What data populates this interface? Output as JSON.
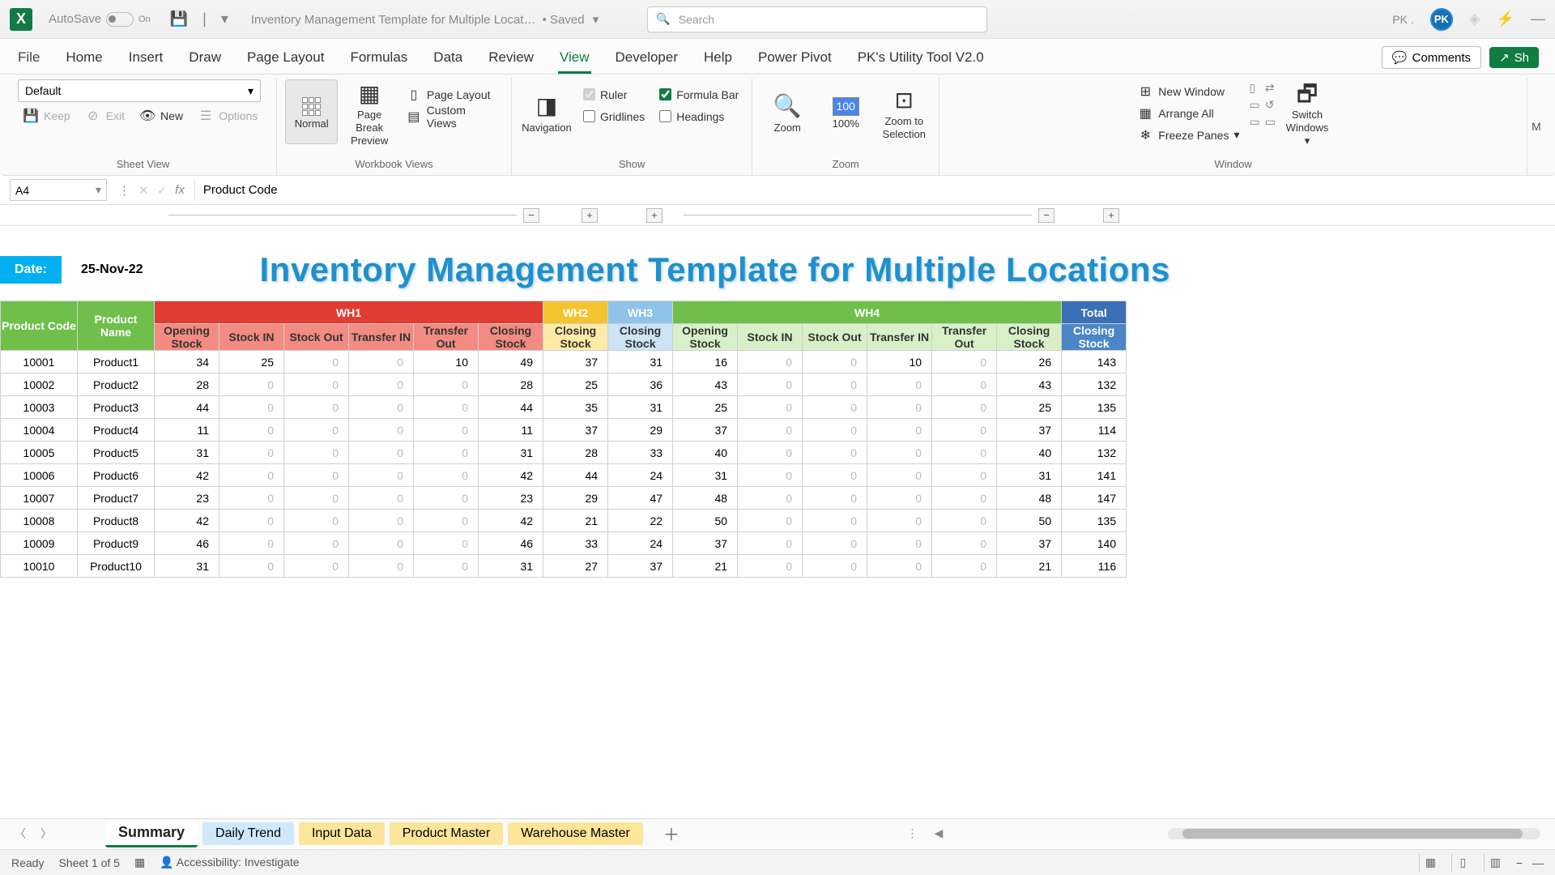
{
  "title_bar": {
    "autosave_label": "AutoSave",
    "autosave_state": "On",
    "file_name": "Inventory Management Template for Multiple Locat…",
    "saved_state": "• Saved",
    "search_placeholder": "Search",
    "user_initials": "PK ."
  },
  "tabs": {
    "file": "File",
    "home": "Home",
    "insert": "Insert",
    "draw": "Draw",
    "page_layout": "Page Layout",
    "formulas": "Formulas",
    "data": "Data",
    "review": "Review",
    "view": "View",
    "developer": "Developer",
    "help": "Help",
    "power_pivot": "Power Pivot",
    "pk_tool": "PK's Utility Tool V2.0",
    "comments": "Comments",
    "share": "Sh"
  },
  "ribbon": {
    "sheet_view": {
      "select": "Default",
      "keep": "Keep",
      "exit": "Exit",
      "new": "New",
      "options": "Options",
      "group": "Sheet View"
    },
    "workbook_views": {
      "normal": "Normal",
      "page_break": "Page Break Preview",
      "page_layout": "Page Layout",
      "custom_views": "Custom Views",
      "group": "Workbook Views"
    },
    "navigation": {
      "nav": "Navigation"
    },
    "show": {
      "ruler": "Ruler",
      "formula_bar": "Formula Bar",
      "gridlines": "Gridlines",
      "headings": "Headings",
      "group": "Show"
    },
    "zoom": {
      "zoom": "Zoom",
      "z100": "100%",
      "zoom_sel": "Zoom to Selection",
      "group": "Zoom"
    },
    "window": {
      "new_window": "New Window",
      "arrange_all": "Arrange All",
      "freeze_panes": "Freeze Panes",
      "switch": "Switch Windows",
      "group": "Window"
    }
  },
  "formula_bar": {
    "cell": "A4",
    "formula": "Product Code"
  },
  "sheet": {
    "date_label": "Date:",
    "date_value": "25-Nov-22",
    "title": "Inventory Management Template for Multiple Locations",
    "groups": {
      "wh1": "WH1",
      "wh2": "WH2",
      "wh3": "WH3",
      "wh4": "WH4",
      "total": "Total"
    },
    "headers": {
      "pcode": "Product Code",
      "pname": "Product Name",
      "open": "Opening Stock",
      "sin": "Stock IN",
      "sout": "Stock Out",
      "tin": "Transfer IN",
      "tout": "Transfer Out",
      "close": "Closing Stock"
    },
    "rows": [
      {
        "code": "10001",
        "name": "Product1",
        "w1": [
          34,
          25,
          0,
          0,
          10,
          49
        ],
        "w2c": 37,
        "w3c": 31,
        "w4": [
          16,
          0,
          0,
          10,
          0,
          26
        ],
        "tot": 143
      },
      {
        "code": "10002",
        "name": "Product2",
        "w1": [
          28,
          0,
          0,
          0,
          0,
          28
        ],
        "w2c": 25,
        "w3c": 36,
        "w4": [
          43,
          0,
          0,
          0,
          0,
          43
        ],
        "tot": 132
      },
      {
        "code": "10003",
        "name": "Product3",
        "w1": [
          44,
          0,
          0,
          0,
          0,
          44
        ],
        "w2c": 35,
        "w3c": 31,
        "w4": [
          25,
          0,
          0,
          0,
          0,
          25
        ],
        "tot": 135
      },
      {
        "code": "10004",
        "name": "Product4",
        "w1": [
          11,
          0,
          0,
          0,
          0,
          11
        ],
        "w2c": 37,
        "w3c": 29,
        "w4": [
          37,
          0,
          0,
          0,
          0,
          37
        ],
        "tot": 114
      },
      {
        "code": "10005",
        "name": "Product5",
        "w1": [
          31,
          0,
          0,
          0,
          0,
          31
        ],
        "w2c": 28,
        "w3c": 33,
        "w4": [
          40,
          0,
          0,
          0,
          0,
          40
        ],
        "tot": 132
      },
      {
        "code": "10006",
        "name": "Product6",
        "w1": [
          42,
          0,
          0,
          0,
          0,
          42
        ],
        "w2c": 44,
        "w3c": 24,
        "w4": [
          31,
          0,
          0,
          0,
          0,
          31
        ],
        "tot": 141
      },
      {
        "code": "10007",
        "name": "Product7",
        "w1": [
          23,
          0,
          0,
          0,
          0,
          23
        ],
        "w2c": 29,
        "w3c": 47,
        "w4": [
          48,
          0,
          0,
          0,
          0,
          48
        ],
        "tot": 147
      },
      {
        "code": "10008",
        "name": "Product8",
        "w1": [
          42,
          0,
          0,
          0,
          0,
          42
        ],
        "w2c": 21,
        "w3c": 22,
        "w4": [
          50,
          0,
          0,
          0,
          0,
          50
        ],
        "tot": 135
      },
      {
        "code": "10009",
        "name": "Product9",
        "w1": [
          46,
          0,
          0,
          0,
          0,
          46
        ],
        "w2c": 33,
        "w3c": 24,
        "w4": [
          37,
          0,
          0,
          0,
          0,
          37
        ],
        "tot": 140
      },
      {
        "code": "10010",
        "name": "Product10",
        "w1": [
          31,
          0,
          0,
          0,
          0,
          31
        ],
        "w2c": 27,
        "w3c": 37,
        "w4": [
          21,
          0,
          0,
          0,
          0,
          21
        ],
        "tot": 116
      }
    ]
  },
  "sheet_tabs": {
    "summary": "Summary",
    "daily": "Daily Trend",
    "input": "Input Data",
    "product": "Product Master",
    "warehouse": "Warehouse Master"
  },
  "status": {
    "ready": "Ready",
    "sheet": "Sheet 1 of 5",
    "acc": "Accessibility: Investigate"
  }
}
